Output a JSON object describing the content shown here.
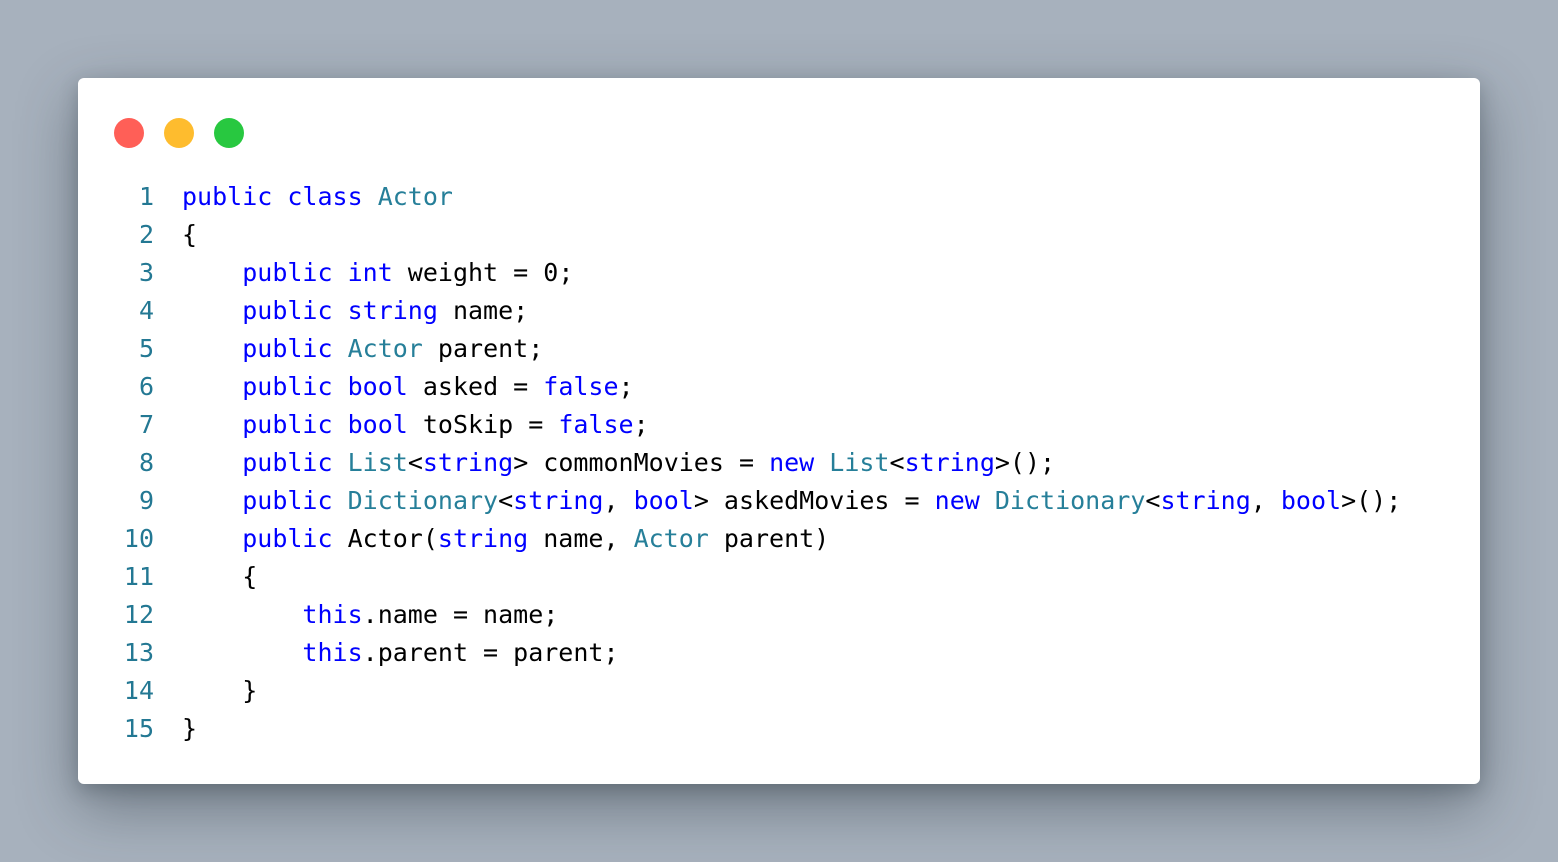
{
  "window": {
    "controls": {
      "close_color": "#ff5f57",
      "minimize_color": "#febc2e",
      "maximize_color": "#28c840"
    }
  },
  "code": {
    "language": "C#",
    "colors": {
      "keyword": "#0000ff",
      "type": "#267f99",
      "plain": "#000000",
      "line_number": "#237893"
    },
    "lines": [
      {
        "n": "1",
        "tokens": [
          [
            "public",
            "k"
          ],
          [
            " ",
            "p"
          ],
          [
            "class",
            "k"
          ],
          [
            " ",
            "p"
          ],
          [
            "Actor",
            "t"
          ]
        ]
      },
      {
        "n": "2",
        "tokens": [
          [
            "{",
            "p"
          ]
        ]
      },
      {
        "n": "3",
        "tokens": [
          [
            "    ",
            "p"
          ],
          [
            "public",
            "k"
          ],
          [
            " ",
            "p"
          ],
          [
            "int",
            "k"
          ],
          [
            " weight = 0;",
            "p"
          ]
        ]
      },
      {
        "n": "4",
        "tokens": [
          [
            "    ",
            "p"
          ],
          [
            "public",
            "k"
          ],
          [
            " ",
            "p"
          ],
          [
            "string",
            "k"
          ],
          [
            " name;",
            "p"
          ]
        ]
      },
      {
        "n": "5",
        "tokens": [
          [
            "    ",
            "p"
          ],
          [
            "public",
            "k"
          ],
          [
            " ",
            "p"
          ],
          [
            "Actor",
            "t"
          ],
          [
            " parent;",
            "p"
          ]
        ]
      },
      {
        "n": "6",
        "tokens": [
          [
            "    ",
            "p"
          ],
          [
            "public",
            "k"
          ],
          [
            " ",
            "p"
          ],
          [
            "bool",
            "k"
          ],
          [
            " asked = ",
            "p"
          ],
          [
            "false",
            "k"
          ],
          [
            ";",
            "p"
          ]
        ]
      },
      {
        "n": "7",
        "tokens": [
          [
            "    ",
            "p"
          ],
          [
            "public",
            "k"
          ],
          [
            " ",
            "p"
          ],
          [
            "bool",
            "k"
          ],
          [
            " toSkip = ",
            "p"
          ],
          [
            "false",
            "k"
          ],
          [
            ";",
            "p"
          ]
        ]
      },
      {
        "n": "8",
        "tokens": [
          [
            "    ",
            "p"
          ],
          [
            "public",
            "k"
          ],
          [
            " ",
            "p"
          ],
          [
            "List",
            "t"
          ],
          [
            "<",
            "p"
          ],
          [
            "string",
            "k"
          ],
          [
            "> commonMovies = ",
            "p"
          ],
          [
            "new",
            "k"
          ],
          [
            " ",
            "p"
          ],
          [
            "List",
            "t"
          ],
          [
            "<",
            "p"
          ],
          [
            "string",
            "k"
          ],
          [
            ">();",
            "p"
          ]
        ]
      },
      {
        "n": "9",
        "tokens": [
          [
            "    ",
            "p"
          ],
          [
            "public",
            "k"
          ],
          [
            " ",
            "p"
          ],
          [
            "Dictionary",
            "t"
          ],
          [
            "<",
            "p"
          ],
          [
            "string",
            "k"
          ],
          [
            ", ",
            "p"
          ],
          [
            "bool",
            "k"
          ],
          [
            "> askedMovies = ",
            "p"
          ],
          [
            "new",
            "k"
          ],
          [
            " ",
            "p"
          ],
          [
            "Dictionary",
            "t"
          ],
          [
            "<",
            "p"
          ],
          [
            "string",
            "k"
          ],
          [
            ", ",
            "p"
          ],
          [
            "bool",
            "k"
          ],
          [
            ">();",
            "p"
          ]
        ]
      },
      {
        "n": "10",
        "tokens": [
          [
            "    ",
            "p"
          ],
          [
            "public",
            "k"
          ],
          [
            " Actor(",
            "p"
          ],
          [
            "string",
            "k"
          ],
          [
            " name, ",
            "p"
          ],
          [
            "Actor",
            "t"
          ],
          [
            " parent)",
            "p"
          ]
        ]
      },
      {
        "n": "11",
        "tokens": [
          [
            "    {",
            "p"
          ]
        ]
      },
      {
        "n": "12",
        "tokens": [
          [
            "        ",
            "p"
          ],
          [
            "this",
            "k"
          ],
          [
            ".name = name;",
            "p"
          ]
        ]
      },
      {
        "n": "13",
        "tokens": [
          [
            "        ",
            "p"
          ],
          [
            "this",
            "k"
          ],
          [
            ".parent = parent;",
            "p"
          ]
        ]
      },
      {
        "n": "14",
        "tokens": [
          [
            "    }",
            "p"
          ]
        ]
      },
      {
        "n": "15",
        "tokens": [
          [
            "}",
            "p"
          ]
        ]
      }
    ]
  }
}
